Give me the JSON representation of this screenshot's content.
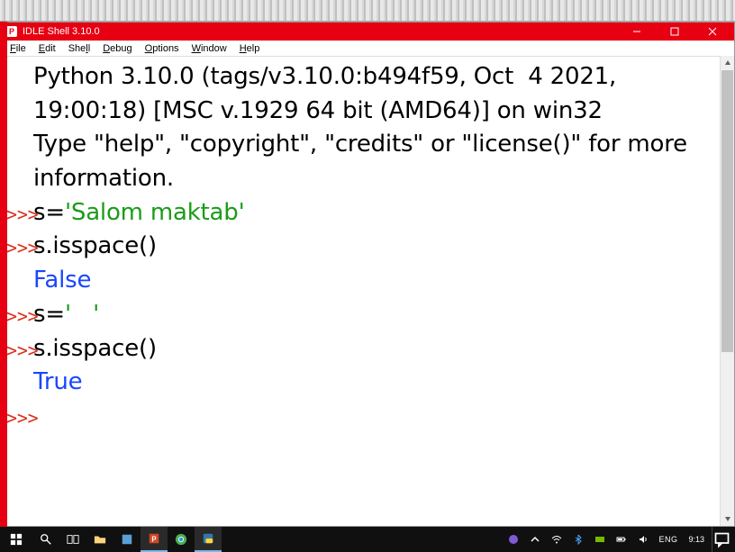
{
  "titlebar": {
    "title": "IDLE Shell 3.10.0"
  },
  "menus": {
    "file": {
      "u": "F",
      "rest": "ile"
    },
    "edit": {
      "u": "E",
      "rest": "dit"
    },
    "shell": {
      "pre": "She",
      "u": "l",
      "rest": "l"
    },
    "debug": {
      "u": "D",
      "rest": "ebug"
    },
    "options": {
      "u": "O",
      "rest": "ptions"
    },
    "window": {
      "u": "W",
      "rest": "indow"
    },
    "help": {
      "u": "H",
      "rest": "elp"
    }
  },
  "shell": {
    "banner1": "Python 3.10.0 (tags/v3.10.0:b494f59, Oct  4 2021, 19:00:18) [MSC v.1929 64 bit (AMD64)] on win32",
    "banner2": "Type \"help\", \"copyright\", \"credits\" or \"license()\" for more information.",
    "prompt": ">>>",
    "line1_pre": "s=",
    "line1_str": "'Salom maktab'",
    "line2": "s.isspace()",
    "out1": "False",
    "line3_pre": "s=",
    "line3_str": "'   '",
    "line4": "s.isspace()",
    "out2": "True"
  },
  "tray": {
    "lang": "ENG",
    "time": "9:13"
  }
}
